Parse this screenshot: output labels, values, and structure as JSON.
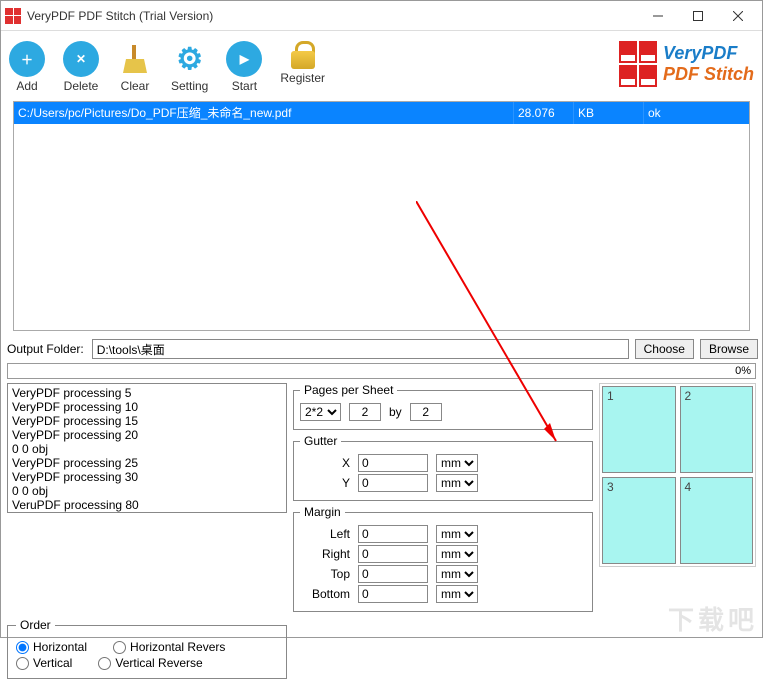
{
  "title": "VeryPDF PDF Stitch (Trial Version)",
  "toolbar": {
    "add": "Add",
    "delete": "Delete",
    "clear": "Clear",
    "setting": "Setting",
    "start": "Start",
    "register": "Register"
  },
  "brand": {
    "line1": "VeryPDF",
    "line2": "PDF Stitch"
  },
  "file": {
    "path": "C:/Users/pc/Pictures/Do_PDF压缩_未命名_new.pdf",
    "size": "28.076",
    "unit": "KB",
    "status": "ok"
  },
  "output": {
    "label": "Output Folder:",
    "value": "D:\\tools\\桌面",
    "choose": "Choose",
    "browse": "Browse"
  },
  "progress": "0%",
  "log": "VeryPDF processing 5\nVeryPDF processing 10\nVeryPDF processing 15\nVeryPDF processing 20\n0 0 obj\nVeryPDF processing 25\nVeryPDF processing 30\n0 0 obj\nVeruPDF processing 80",
  "pages": {
    "legend": "Pages per Sheet",
    "preset": "2*2",
    "w": "2",
    "by": "by",
    "h": "2"
  },
  "gutter": {
    "legend": "Gutter",
    "x": "X",
    "xval": "0",
    "y": "Y",
    "yval": "0",
    "unit": "mm"
  },
  "margin": {
    "legend": "Margin",
    "left": "Left",
    "right": "Right",
    "top": "Top",
    "bottom": "Bottom",
    "val": "0",
    "unit": "mm"
  },
  "preview": {
    "p1": "1",
    "p2": "2",
    "p3": "3",
    "p4": "4"
  },
  "order": {
    "legend": "Order",
    "h": "Horizontal",
    "hr": "Horizontal Revers",
    "v": "Vertical",
    "vr": "Vertical Reverse"
  }
}
